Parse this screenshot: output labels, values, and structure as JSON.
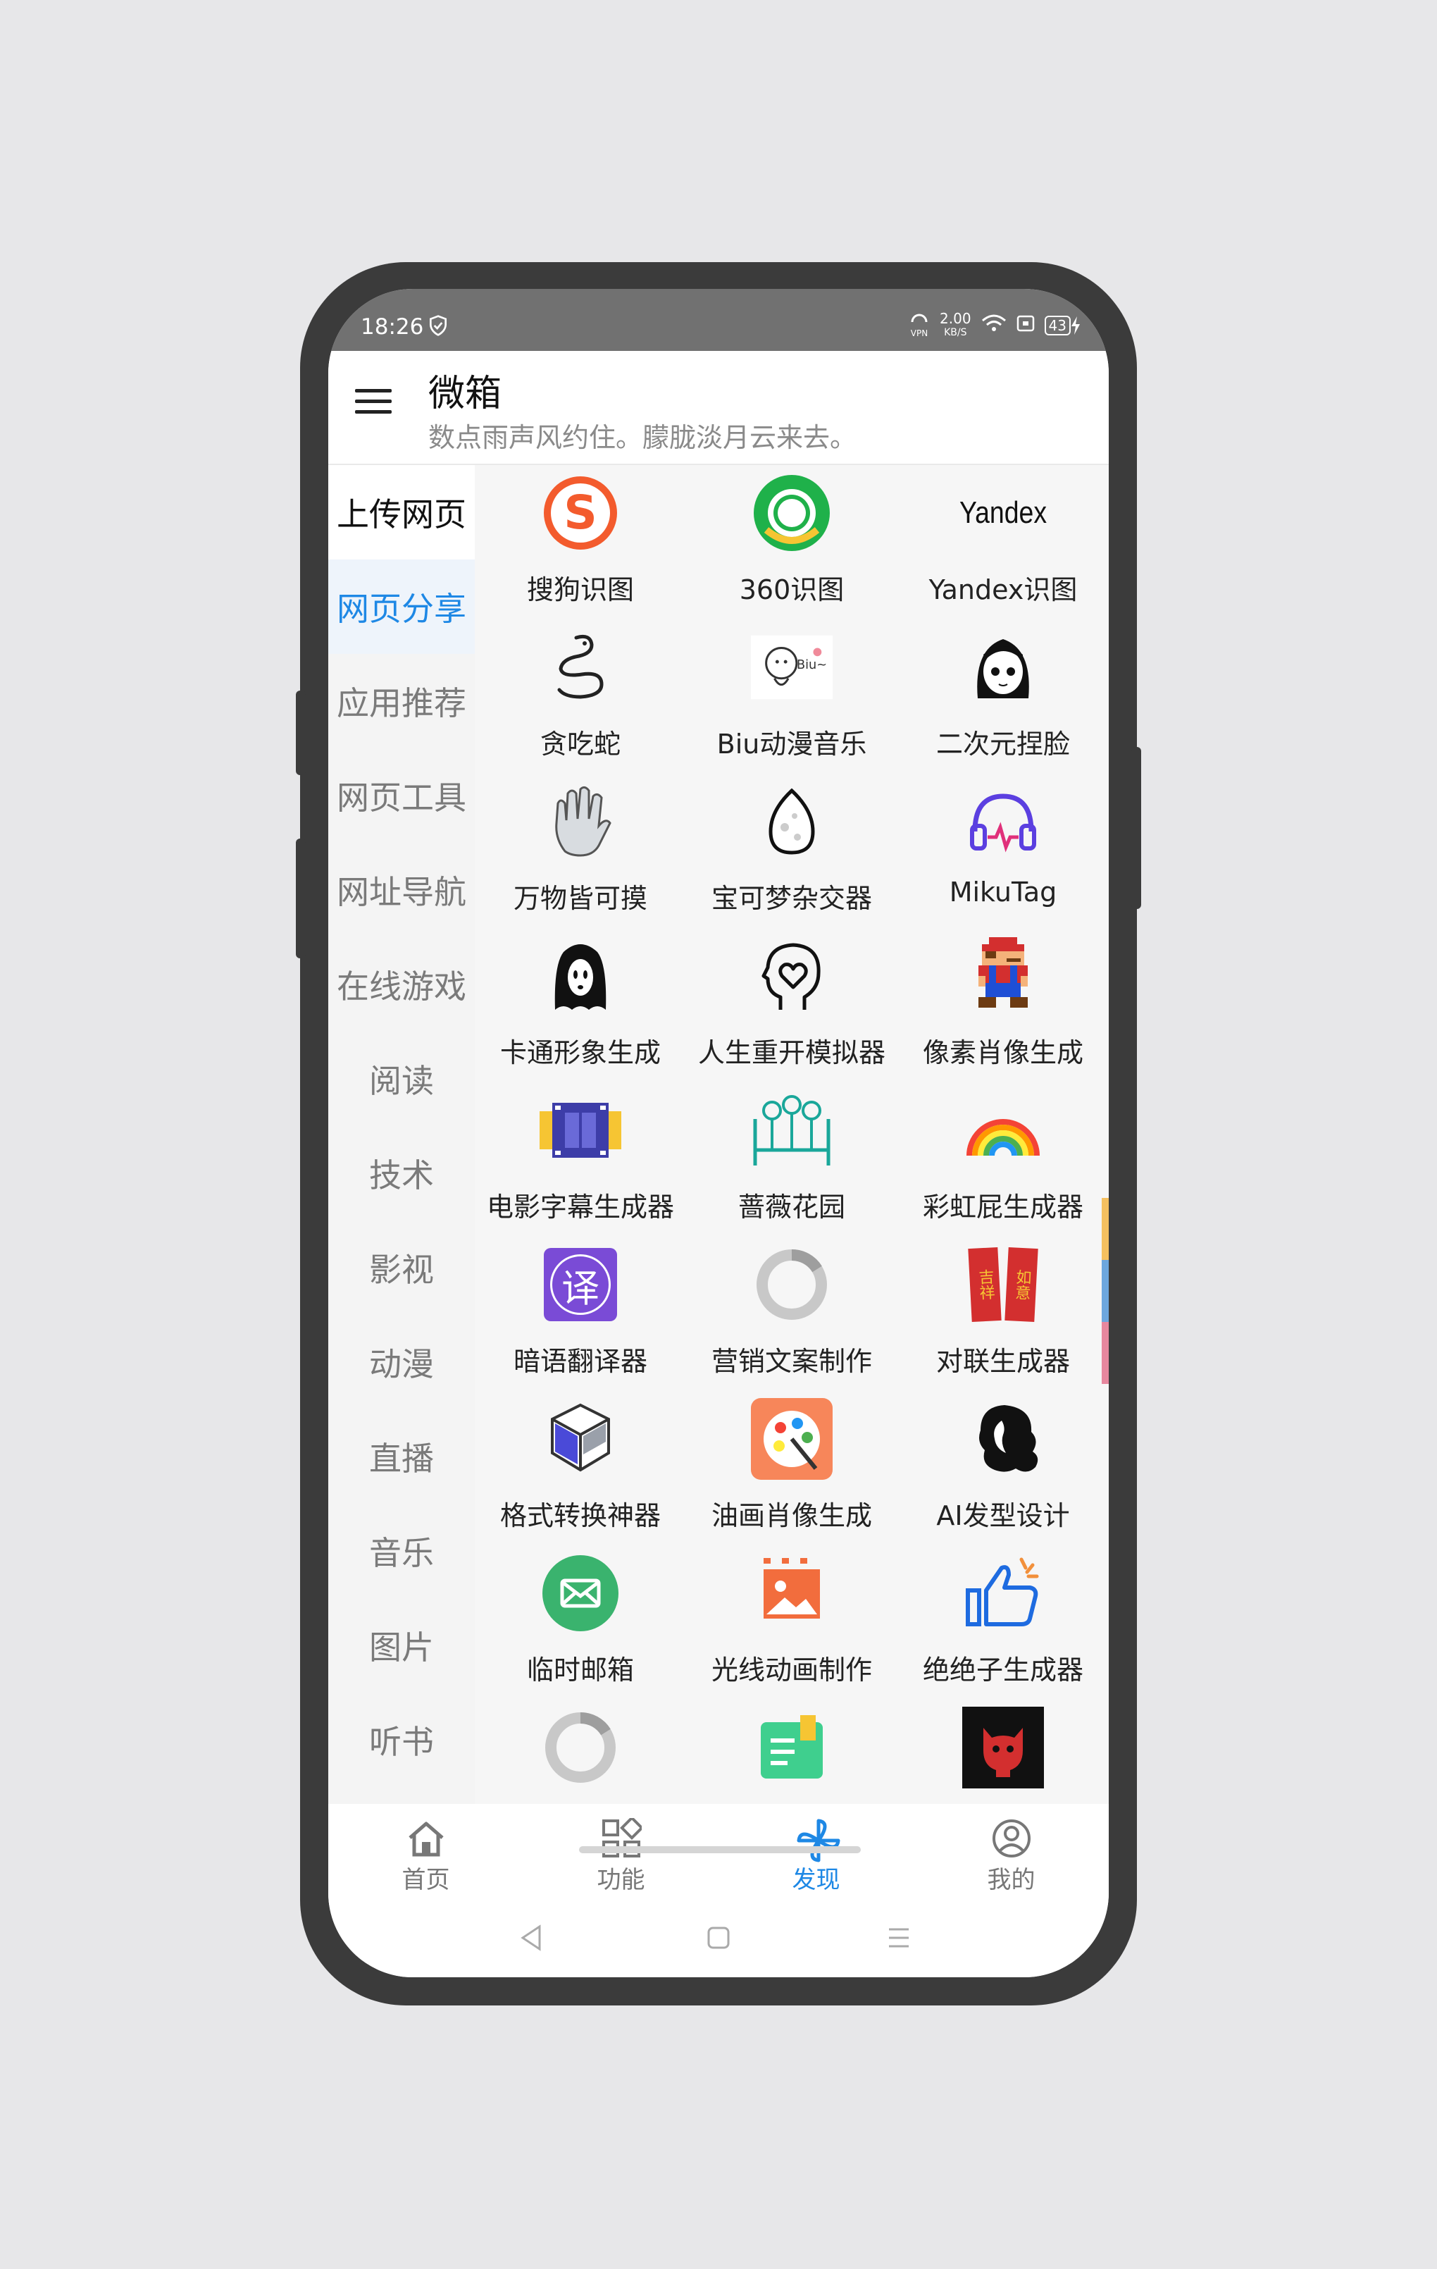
{
  "status_bar": {
    "time": "18:26",
    "speed_value": "2.00",
    "speed_unit": "KB/S",
    "vpn": "VPN",
    "battery": "43"
  },
  "header": {
    "title": "微箱",
    "subtitle": "数点雨声风约住。朦胧淡月云来去。"
  },
  "sidebar": {
    "items": [
      {
        "label": "上传网页"
      },
      {
        "label": "网页分享"
      },
      {
        "label": "应用推荐"
      },
      {
        "label": "网页工具"
      },
      {
        "label": "网址导航"
      },
      {
        "label": "在线游戏"
      },
      {
        "label": "阅读"
      },
      {
        "label": "技术"
      },
      {
        "label": "影视"
      },
      {
        "label": "动漫"
      },
      {
        "label": "直播"
      },
      {
        "label": "音乐"
      },
      {
        "label": "图片"
      },
      {
        "label": "听书"
      }
    ]
  },
  "grid": {
    "items": [
      {
        "label": "搜狗识图",
        "icon": "sogou-icon"
      },
      {
        "label": "360识图",
        "icon": "360-icon"
      },
      {
        "label": "Yandex识图",
        "icon": "yandex-icon",
        "icon_text": "Yandex"
      },
      {
        "label": "贪吃蛇",
        "icon": "snake-icon"
      },
      {
        "label": "Biu动漫音乐",
        "icon": "biu-icon",
        "icon_text": "Biu~"
      },
      {
        "label": "二次元捏脸",
        "icon": "anime-face-icon"
      },
      {
        "label": "万物皆可摸",
        "icon": "hand-icon"
      },
      {
        "label": "宝可梦杂交器",
        "icon": "egg-icon"
      },
      {
        "label": "MikuTag",
        "icon": "headphones-icon"
      },
      {
        "label": "卡通形象生成",
        "icon": "ghost-icon"
      },
      {
        "label": "人生重开模拟器",
        "icon": "head-heart-icon"
      },
      {
        "label": "像素肖像生成",
        "icon": "pixel-mario-icon"
      },
      {
        "label": "电影字幕生成器",
        "icon": "film-icon"
      },
      {
        "label": "蔷薇花园",
        "icon": "garden-icon"
      },
      {
        "label": "彩虹屁生成器",
        "icon": "rainbow-icon"
      },
      {
        "label": "暗语翻译器",
        "icon": "translate-icon",
        "icon_text": "译"
      },
      {
        "label": "营销文案制作",
        "icon": "ring-icon"
      },
      {
        "label": "对联生成器",
        "icon": "couplet-icon",
        "icon_text_left": "吉祥",
        "icon_text_right": "如意"
      },
      {
        "label": "格式转换神器",
        "icon": "cube-icon"
      },
      {
        "label": "油画肖像生成",
        "icon": "palette-icon"
      },
      {
        "label": "AI发型设计",
        "icon": "hair-icon"
      },
      {
        "label": "临时邮箱",
        "icon": "mail-icon"
      },
      {
        "label": "光线动画制作",
        "icon": "image-anim-icon"
      },
      {
        "label": "绝绝子生成器",
        "icon": "thumbs-up-icon"
      },
      {
        "label": "",
        "icon": "ring-icon-2"
      },
      {
        "label": "",
        "icon": "book-icon"
      },
      {
        "label": "",
        "icon": "cat-devil-icon"
      }
    ]
  },
  "bottom_nav": {
    "items": [
      {
        "label": "首页",
        "icon": "home-icon"
      },
      {
        "label": "功能",
        "icon": "apps-icon"
      },
      {
        "label": "发现",
        "icon": "pinwheel-icon"
      },
      {
        "label": "我的",
        "icon": "profile-icon"
      }
    ],
    "active": "发现",
    "active_color": "#1e88e5"
  },
  "colors": {
    "accent": "#1e88e5",
    "status_bar": "#717171"
  }
}
